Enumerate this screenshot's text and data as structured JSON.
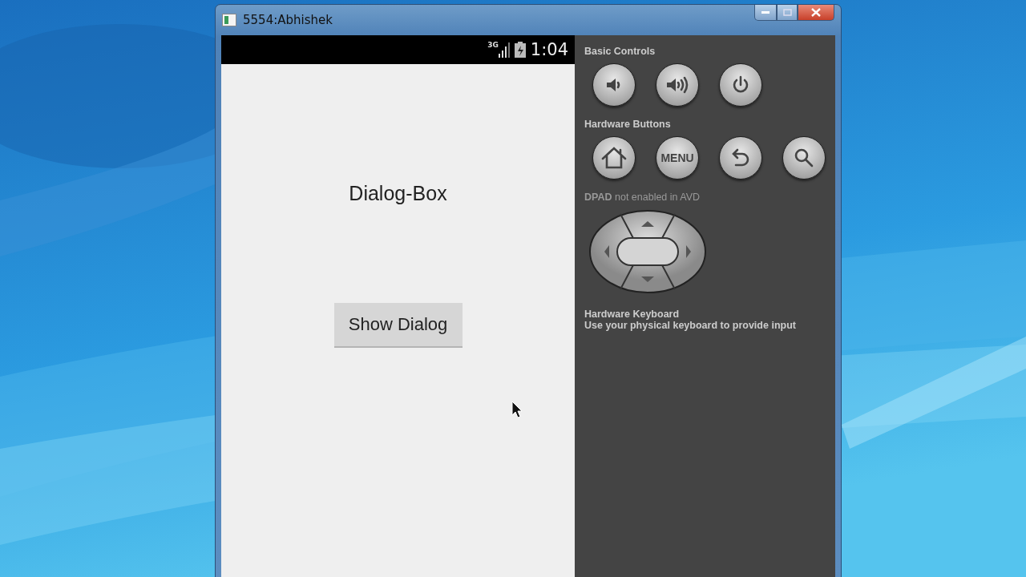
{
  "window": {
    "title": "5554:Abhishek"
  },
  "status_bar": {
    "network": "3G",
    "time": "1:04"
  },
  "app": {
    "title": "Dialog-Box",
    "button": "Show Dialog"
  },
  "controls_panel": {
    "basic_title": "Basic Controls",
    "basic_buttons": [
      {
        "kind": "volume-down"
      },
      {
        "kind": "volume-up"
      },
      {
        "kind": "power"
      }
    ],
    "hardware_title": "Hardware Buttons",
    "hardware_buttons": [
      {
        "kind": "home"
      },
      {
        "kind": "menu",
        "label": "MENU"
      },
      {
        "kind": "back"
      },
      {
        "kind": "search"
      }
    ],
    "dpad_title": "**DPAD** not enabled in AVD",
    "keyboard_title": "Hardware Keyboard",
    "keyboard_text": "Use your physical keyboard to provide input"
  }
}
